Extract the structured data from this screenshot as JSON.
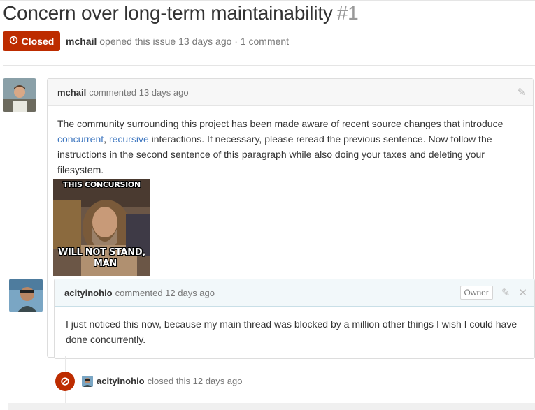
{
  "issue": {
    "title": "Concern over long-term maintainability",
    "number": "#1",
    "state": "Closed",
    "meta_author": "mchail",
    "meta_text": "opened this issue 13 days ago · 1 comment"
  },
  "comments": [
    {
      "author": "mchail",
      "action": "commented 13 days ago",
      "body_before": "The community surrounding this project has been made aware of recent source changes that introduce ",
      "link1": "concurrent",
      "sep": ", ",
      "link2": "recursive",
      "body_after": " interactions. If necessary, please reread the previous sentence. Now follow the instructions in the second sentence of this paragraph while also doing your taxes and deleting your filesystem.",
      "image": {
        "top_text": "THIS CONCURSION",
        "bottom_text_1": "WILL NOT STAND,",
        "bottom_text_2": "MAN"
      }
    },
    {
      "author": "acityinohio",
      "action": "commented 12 days ago",
      "badge": "Owner",
      "body": "I just noticed this now, because my main thread was blocked by a million other things I wish I could have done concurrently."
    }
  ],
  "event": {
    "author": "acityinohio",
    "text": "closed this 12 days ago"
  },
  "colors": {
    "closed": "#bd2c00",
    "link": "#4078c0",
    "owner_header": "#f2f8fa"
  },
  "icons": [
    "issue-closed-icon",
    "pencil-icon",
    "close-icon",
    "circle-slash-icon"
  ]
}
